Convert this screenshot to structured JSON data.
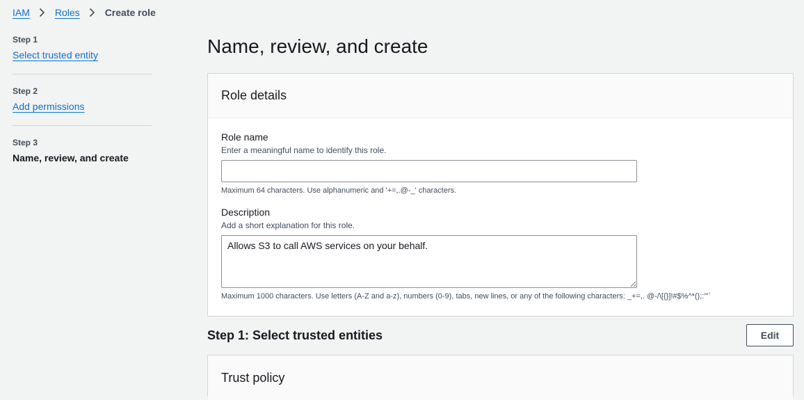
{
  "breadcrumb": {
    "items": [
      "IAM",
      "Roles"
    ],
    "current": "Create role"
  },
  "steps": [
    {
      "number": "Step 1",
      "title": "Select trusted entity"
    },
    {
      "number": "Step 2",
      "title": "Add permissions"
    },
    {
      "number": "Step 3",
      "title": "Name, review, and create"
    }
  ],
  "main": {
    "title": "Name, review, and create",
    "role_details": {
      "header": "Role details",
      "role_name": {
        "label": "Role name",
        "description": "Enter a meaningful name to identify this role.",
        "value": "",
        "constraint": "Maximum 64 characters. Use alphanumeric and '+=,.@-_' characters."
      },
      "description": {
        "label": "Description",
        "description": "Add a short explanation for this role.",
        "value": "Allows S3 to call AWS services on your behalf.",
        "constraint": "Maximum 1000 characters. Use letters (A-Z and a-z), numbers (0-9), tabs, new lines, or any of the following characters: _+=,. @-/\\[{}]!#$%^*();:\"'`"
      }
    },
    "step1_section": {
      "title": "Step 1: Select trusted entities",
      "edit_label": "Edit"
    },
    "trust_policy": {
      "header": "Trust policy"
    }
  },
  "colors": {
    "link": "#0972d3",
    "background": "#f2f3f3",
    "text": "#16191f"
  }
}
